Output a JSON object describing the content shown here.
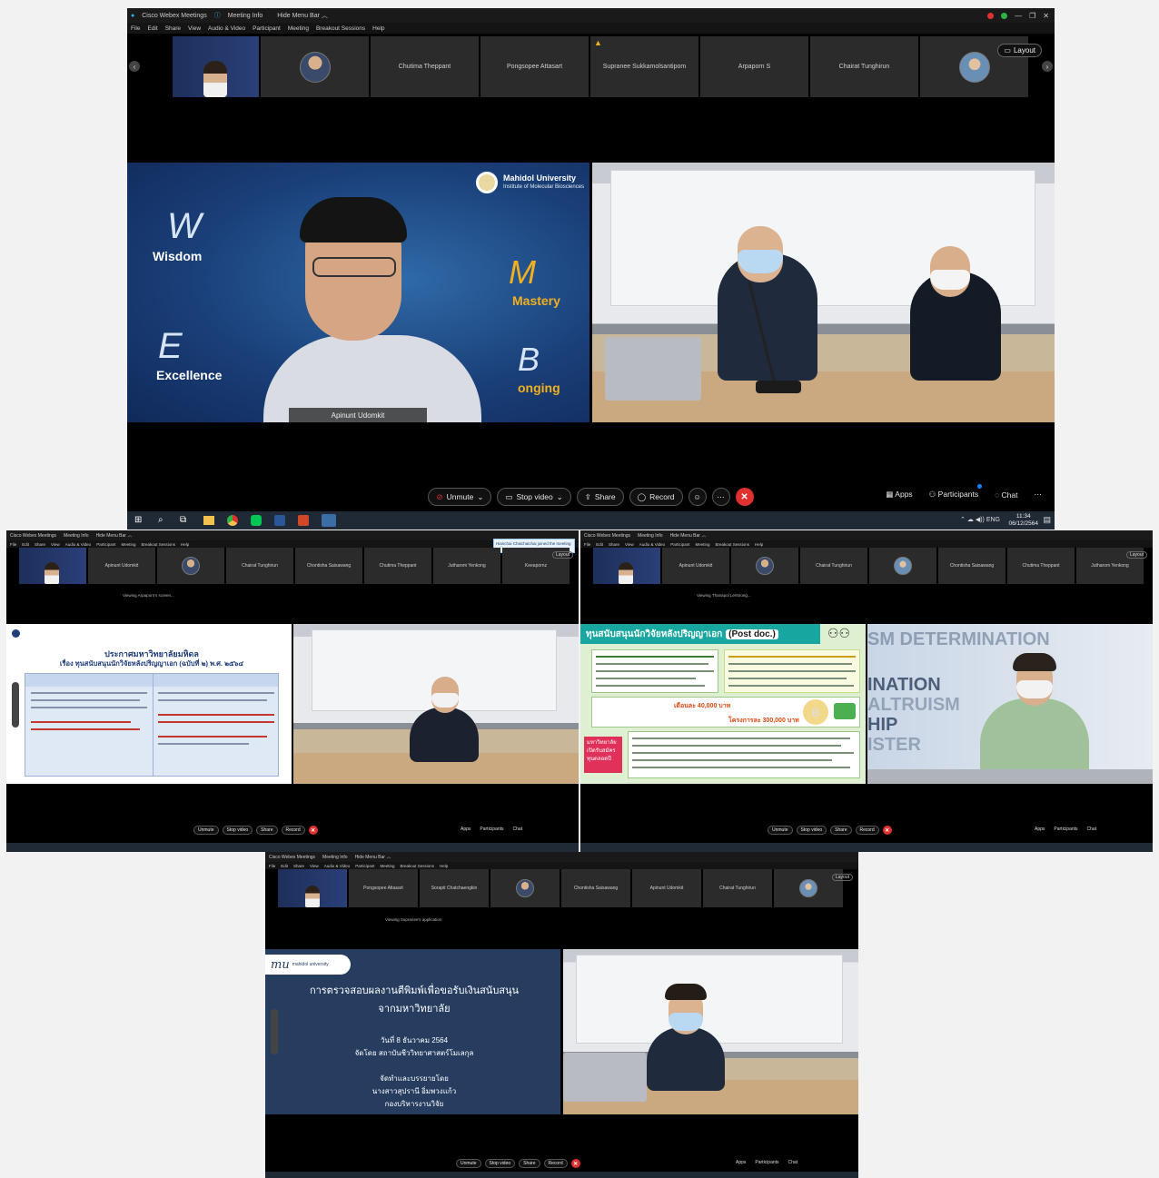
{
  "main": {
    "title_bar": {
      "app": "Cisco Webex Meetings",
      "meeting_info": "Meeting Info",
      "hide_menu": "Hide Menu Bar ︿"
    },
    "menu": [
      "File",
      "Edit",
      "Share",
      "View",
      "Audio & Video",
      "Participant",
      "Meeting",
      "Breakout Sessions",
      "Help"
    ],
    "participants_strip": [
      "",
      "",
      "Chutima Theppant",
      "Pongsopee Attasart",
      "Supranee Sukkamolsantipom",
      "Arpaporn S",
      "Chairat Tunghirun",
      ""
    ],
    "layout_label": "Layout",
    "speaker_name": "Apinunt Udomkit",
    "brand": {
      "name": "Mahidol University",
      "sub": "Institute of Molecular Biosciences"
    },
    "values": [
      "Wisdom",
      "Mastery",
      "Excellence",
      "onging"
    ],
    "toolbar": {
      "unmute": "Unmute",
      "stop_video": "Stop video",
      "share": "Share",
      "record": "Record",
      "apps": "Apps",
      "participants": "Participants",
      "chat": "Chat"
    },
    "clock": {
      "time": "11:34",
      "date": "06/12/2564"
    },
    "colors": {
      "end_red": "#e03131",
      "accent_blue": "#0a84ff",
      "slide_navy": "#263d5f"
    }
  },
  "left": {
    "strip": [
      "",
      "Apinunt Udomkit",
      "",
      "Chairat Tunghirun",
      "Chontisha Saisawang",
      "Chutima Theppant",
      "Jutharom Yenkong",
      "Keeapornz"
    ],
    "viewing": "Viewing Arpaporn's screen...",
    "notice": "Hianchai Chaichaichai joined the meeting",
    "slide_heading": "ประกาศมหาวิทยาลัยมหิดล",
    "slide_subject": "เรื่อง   ทุนสนับสนุนนักวิจัยหลังปริญญาเอก  (ฉบับที่ ๒) พ.ศ. ๒๕๖๔",
    "layout_label": "Layout"
  },
  "right": {
    "strip": [
      "",
      "Apinunt Udomkit",
      "",
      "Chairat Tunghirun",
      "",
      "Chontisha Saisawang",
      "Chutima Theppant",
      "Jutharom Yenkong"
    ],
    "viewing": "Viewing Thanapol Lertsrong...",
    "slide_title": "ทุนสนับสนุนนักวิจัยหลังปริญญาเอก",
    "slide_title_en": "(Post doc.)",
    "salary": "เดือนละ 40,000 บาท",
    "project": "โครงการละ 300,000 บาท",
    "univ_note": "มหาวิทยาลัยเปิดรับสมัครทุนตลอดปี",
    "wall_words": [
      "SM DETERMINATION",
      "INATION",
      "ALTRUISM",
      "HIP",
      "ISTER"
    ],
    "layout_label": "Layout"
  },
  "bottom": {
    "strip": [
      "",
      "Pongsopee Attasart",
      "Sorapit Chatchaengkin",
      "",
      "Chontisha Saisawang",
      "Apinunt Udomkit",
      "Chairat Tunghirun",
      ""
    ],
    "viewing": "Viewing Supranee's application",
    "logo_text": "mahidol university",
    "slide_title_1": "การตรวจสอบผลงานตีพิมพ์เพื่อขอรับเงินสนับสนุน",
    "slide_title_2": "จากมหาวิทยาลัย",
    "date_line": "วันที่ 8 ธันวาคม 2564",
    "organizer": "จัดโดย  สถาบันชีววิทยาศาสตร์โมเลกุล",
    "presenter_label": "จัดทำและบรรยายโดย",
    "presenter_name": "นางสาวสุปรานี อิ่มพวงแก้ว",
    "presenter_dept": "กองบริหารงานวิจัย",
    "layout_label": "Layout"
  }
}
